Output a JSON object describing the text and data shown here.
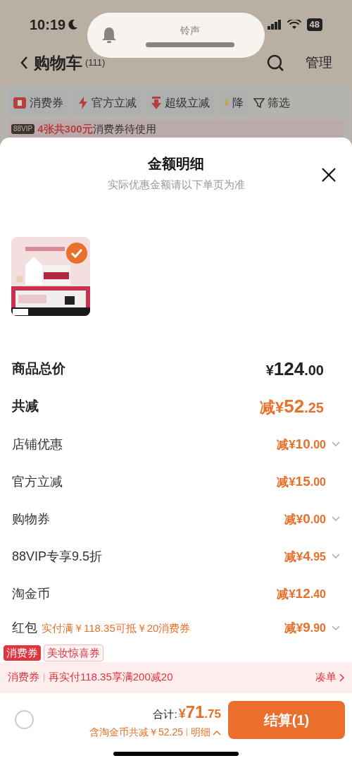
{
  "status_bar": {
    "time": "10:19",
    "battery": "48"
  },
  "toast": {
    "title": "铃声"
  },
  "header": {
    "title": "购物车",
    "count": "(111)",
    "manage": "管理"
  },
  "filters": [
    {
      "label": "消费券",
      "kind": "coupon"
    },
    {
      "label": "官方立减",
      "kind": "bolt"
    },
    {
      "label": "超级立减",
      "kind": "down"
    },
    {
      "label": "降",
      "kind": "gold"
    }
  ],
  "filter_button": "筛选",
  "vip_banner": {
    "badge": "88VIP",
    "highlight": "4张共300元",
    "text": "消费券待使用"
  },
  "sheet": {
    "title": "金额明细",
    "subtitle": "实际优惠金额请以下单页为准",
    "product": {
      "kind": "picture",
      "checked": true
    },
    "total": {
      "label": "商品总价",
      "currency": "¥",
      "integer": "124",
      "decimal": ".00"
    },
    "reduction": {
      "label": "共减",
      "prefix": "减¥",
      "integer": "52",
      "decimal": ".25"
    },
    "items": [
      {
        "label": "店铺优惠",
        "prefix": "减¥",
        "integer": "10",
        "decimal": ".00",
        "expandable": true
      },
      {
        "label": "官方立减",
        "prefix": "减¥",
        "integer": "15",
        "decimal": ".00",
        "expandable": false
      },
      {
        "label": "购物券",
        "prefix": "减¥",
        "integer": "0",
        "decimal": ".00",
        "expandable": true
      },
      {
        "label": "88VIP专享9.5折",
        "prefix": "减¥",
        "integer": "4",
        "decimal": ".95",
        "expandable": true
      },
      {
        "label": "淘金币",
        "prefix": "减¥",
        "integer": "12",
        "decimal": ".40",
        "expandable": false
      },
      {
        "label": "红包",
        "note": "实付满￥118.35可抵￥20消费券",
        "prefix": "减¥",
        "integer": "9",
        "decimal": ".90",
        "expandable": true
      }
    ]
  },
  "tags": [
    {
      "label": "消费券",
      "kind": "solid"
    },
    {
      "label": "美妆惊喜券",
      "kind": "outline"
    }
  ],
  "promo": {
    "label": "消费券",
    "text": "再实付118.35享满200减20",
    "action": "凑单"
  },
  "footer": {
    "select_all_checked": false,
    "total_label": "合计:",
    "total_currency": "¥",
    "total_integer": "71",
    "total_decimal": ".75",
    "saving": "含淘金币共减￥52.25",
    "detail": "明细",
    "checkout": "结算(1)"
  }
}
